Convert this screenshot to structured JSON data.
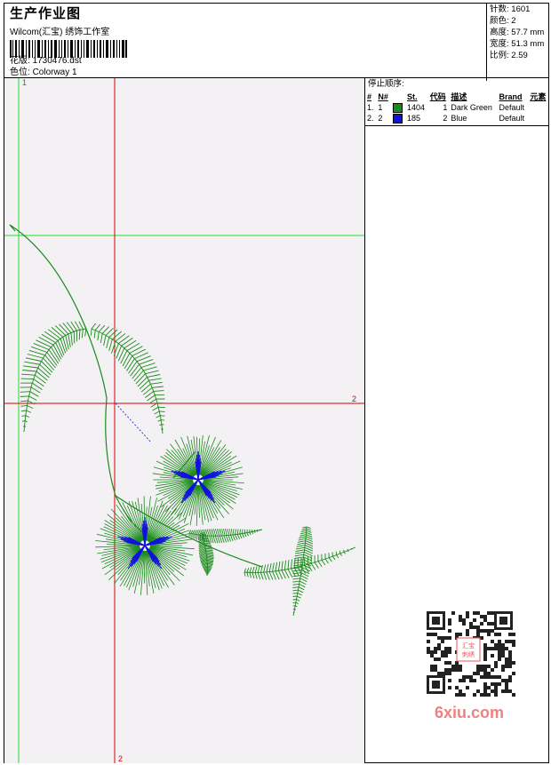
{
  "header": {
    "title": "生产作业图",
    "company": "Wilcom(汇宝) 绣饰工作室",
    "design_label": "花版:",
    "design_value": "1730476.dst",
    "colorway_label": "色位:",
    "colorway_value": "Colorway 1"
  },
  "info": {
    "stitches_label": "针数:",
    "stitches_value": "1601",
    "colors_label": "颜色:",
    "colors_value": "2",
    "height_label": "高度:",
    "height_value": "57.7 mm",
    "width_label": "宽度:",
    "width_value": "51.3 mm",
    "ratio_label": "比例:",
    "ratio_value": "2.59"
  },
  "stop_sequence": {
    "heading": "停止顺序:",
    "columns": [
      "#",
      "N#",
      "St.",
      "代码",
      "描述",
      "Brand",
      "元素"
    ],
    "rows": [
      {
        "num": "1.",
        "n": "1",
        "color": "#1a8a1a",
        "st": "1404",
        "code": "1",
        "desc": "Dark Green",
        "brand": "Default"
      },
      {
        "num": "2.",
        "n": "2",
        "color": "#1010e0",
        "st": "185",
        "code": "2",
        "desc": "Blue",
        "brand": "Default"
      }
    ]
  },
  "canvas": {
    "guide_label_top": "1",
    "guide_label_right": "2",
    "guide_label_bottom": "2"
  },
  "watermark": {
    "text": "6xiu.com",
    "badge_text": "汇宝 刺绣"
  },
  "colors": {
    "green_thread": "#1a8a1a",
    "blue_thread": "#1010e0",
    "guide_green": "#22dd22",
    "guide_red": "#dd0000"
  }
}
